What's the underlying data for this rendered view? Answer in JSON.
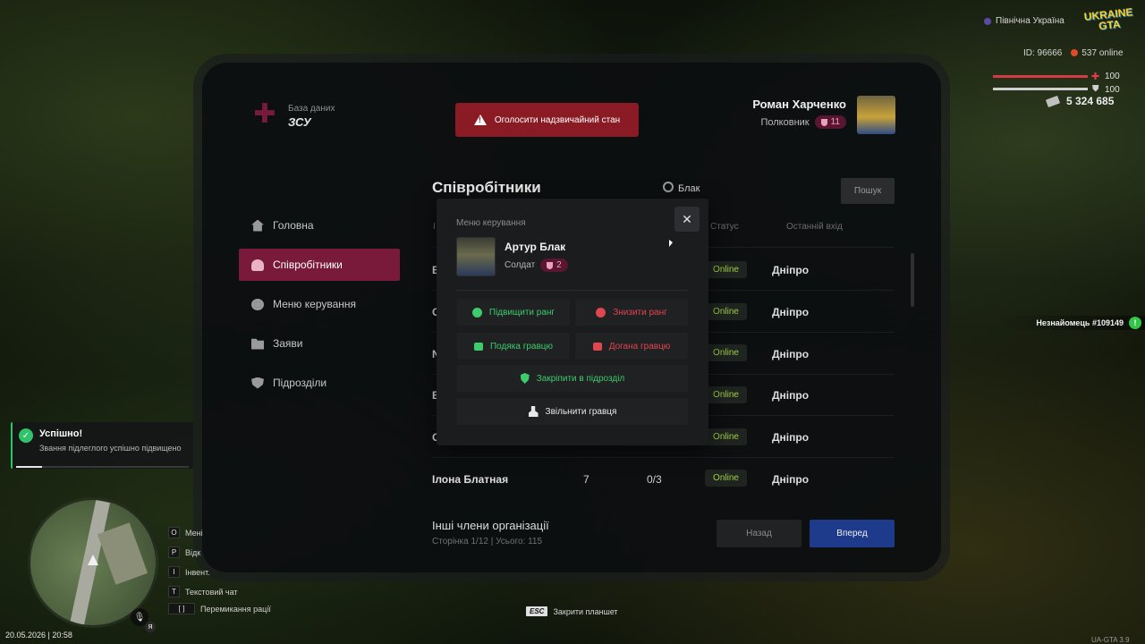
{
  "hud": {
    "region": "Північна Україна",
    "logo_top": "UKRAINE",
    "logo_bottom": "GTA",
    "player_id": "ID: 96666",
    "online": "537 online",
    "health": "100",
    "health_level": 1.0,
    "armor": "100",
    "armor_level": 1.0,
    "money": "5 324 685",
    "stranger": "Незнайомець #109149",
    "datetime": "20.05.2026 | 20:58",
    "version": "UA-GTA 3.9",
    "esc_key": "ESC",
    "esc_label": "Закрити планшет",
    "keyhints": [
      {
        "key": "O",
        "label": "Мені"
      },
      {
        "key": "P",
        "label": "Відк"
      },
      {
        "key": "I",
        "label": "Інвент."
      },
      {
        "key": "T",
        "label": "Текстовий чат"
      },
      {
        "key": "[ ]",
        "label": "Перемикання рації"
      }
    ],
    "toast": {
      "title": "Успішно!",
      "text": "Звання підлеглого успішно підвищено",
      "progress": 0.15
    },
    "you_badge": "Я"
  },
  "tablet": {
    "db_label": "База даних",
    "org": "ЗСУ",
    "emergency_button": "Оголосити надзвичайний стан",
    "user": {
      "name": "Роман Харченко",
      "rank": "Полковник",
      "rank_level": "11"
    },
    "nav": [
      {
        "label": "Головна",
        "icon": "home-icon"
      },
      {
        "label": "Співробітники",
        "icon": "users-icon"
      },
      {
        "label": "Меню керування",
        "icon": "gear-icon"
      },
      {
        "label": "Заяви",
        "icon": "folder-icon"
      },
      {
        "label": "Підрозділи",
        "icon": "shield-icon"
      }
    ],
    "main": {
      "title": "Співробітники",
      "search_value": "Блак",
      "search_button": "Пошук",
      "col_status": "Статус",
      "col_last_login": "Останній вхід",
      "col_first_fragment": "I",
      "rows": [
        {
          "name": "В",
          "status": "Online",
          "city": "Дніпро"
        },
        {
          "name": "С",
          "status": "Online",
          "city": "Дніпро"
        },
        {
          "name": "N",
          "status": "Online",
          "city": "Дніпро"
        },
        {
          "name": "В",
          "status": "Online",
          "city": "Дніпро"
        },
        {
          "name": "С",
          "status": "Online",
          "city": "Дніпро"
        },
        {
          "name": "Ілона Блатная",
          "rank": "7",
          "warnings": "0/3",
          "status": "Online",
          "city": "Дніпро"
        }
      ],
      "other_title": "Інші члени організації",
      "pagination": "Сторінка 1/12 | Усього: 115",
      "back_button": "Назад",
      "next_button": "Вперед"
    },
    "modal": {
      "label": "Меню керування",
      "name": "Артур Блак",
      "rank": "Солдат",
      "rank_level": "2",
      "close": "✕",
      "actions": {
        "promote": "Підвищити ранг",
        "demote": "Знизити ранг",
        "thank": "Подяка гравцю",
        "reprimand": "Догана гравцю",
        "assign": "Закріпити в підрозділ",
        "fire": "Звільнити гравця"
      }
    }
  }
}
